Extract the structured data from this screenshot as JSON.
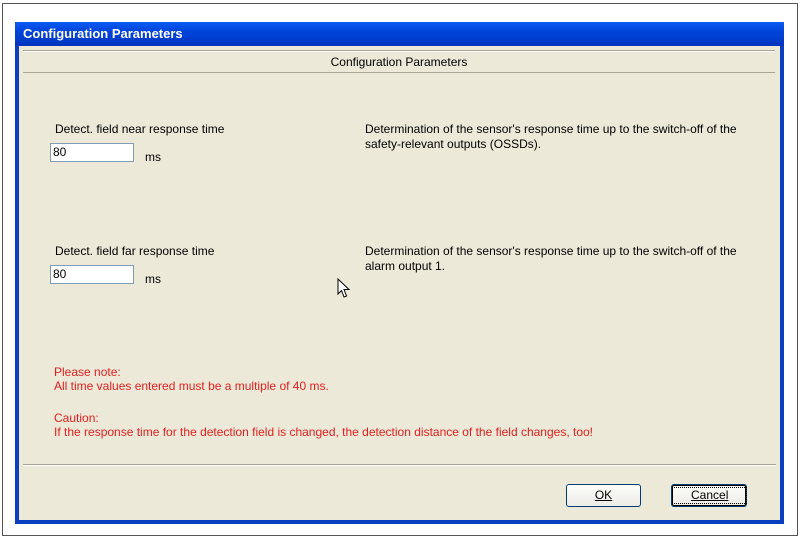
{
  "window": {
    "title": "Configuration Parameters"
  },
  "header": {
    "text": "Configuration Parameters"
  },
  "params": [
    {
      "label": "Detect. field near response time",
      "value": "80",
      "unit": "ms",
      "description": "Determination of the sensor's response time up to the switch-off of the safety-relevant outputs (OSSDs)."
    },
    {
      "label": "Detect. field far response time",
      "value": "80",
      "unit": "ms",
      "description": "Determination of the sensor's response time up to the switch-off of the alarm output 1."
    }
  ],
  "notes": {
    "note_title": "Please note:",
    "note_text": "All time values entered must be a multiple of 40 ms.",
    "caution_title": "Caution:",
    "caution_text": "If the response time for the detection field is changed, the detection distance of the field changes, too!"
  },
  "buttons": {
    "ok": "OK",
    "cancel": "Cancel"
  },
  "colors": {
    "title_bar": "#0043d8",
    "note_text": "#e02020",
    "dialog_bg": "#ece9d8"
  },
  "icons": {
    "cursor": "mouse-pointer-icon"
  }
}
